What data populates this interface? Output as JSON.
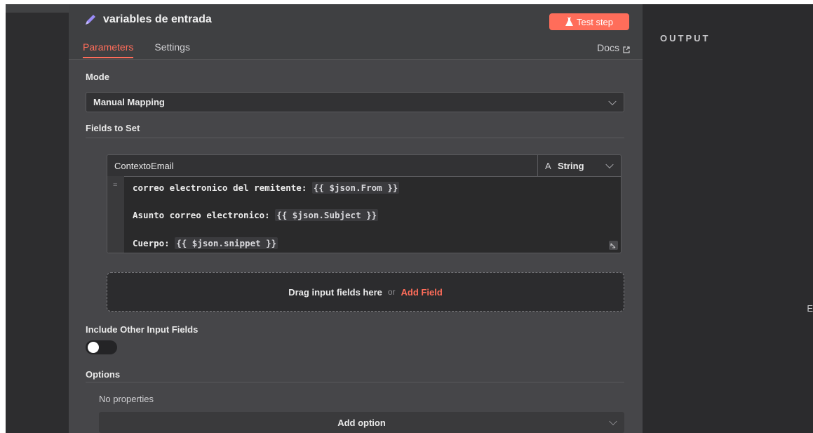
{
  "node": {
    "title": "variables de entrada",
    "test_step_label": "Test step",
    "tabs": [
      "Parameters",
      "Settings"
    ],
    "docs_label": "Docs"
  },
  "params": {
    "mode_label": "Mode",
    "mode_value": "Manual Mapping",
    "fields_label": "Fields to Set",
    "field": {
      "name": "ContextoEmail",
      "type_icon": "A",
      "type": "String",
      "lines": [
        {
          "text": "correo electronico del remitente: ",
          "expr": "{{ $json.From }}"
        },
        {
          "text": "Asunto correo electronico: ",
          "expr": "{{ $json.Subject }}"
        },
        {
          "text": "Cuerpo: ",
          "expr": "{{ $json.snippet }}"
        }
      ]
    },
    "dropzone_text": "Drag input fields here",
    "dropzone_or": "or",
    "dropzone_add": "Add Field",
    "include_label": "Include Other Input Fields",
    "include_value": false,
    "options_label": "Options",
    "no_properties": "No properties",
    "add_option": "Add option"
  },
  "output": {
    "label": "OUTPUT",
    "edge_text": "E"
  },
  "colors": {
    "accent": "#ff6d5a",
    "panel": "#464649",
    "background": "#2d2d2f"
  }
}
